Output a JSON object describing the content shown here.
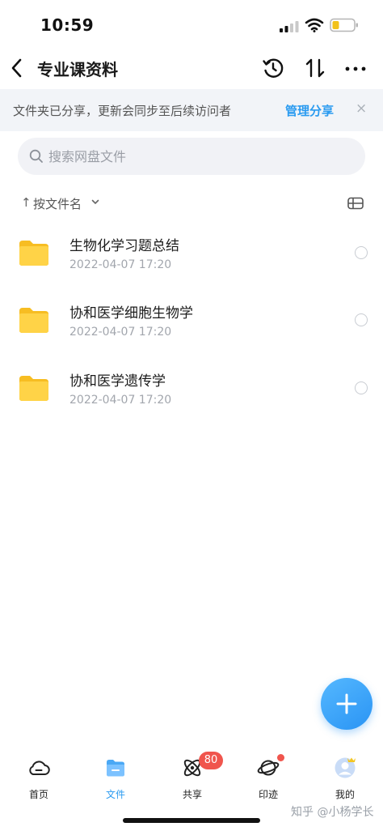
{
  "status_bar": {
    "time": "10:59"
  },
  "nav": {
    "title": "专业课资料"
  },
  "banner": {
    "text": "文件夹已分享，更新会同步至后续访问者",
    "link": "管理分享",
    "close": "×"
  },
  "search": {
    "placeholder": "搜索网盘文件",
    "value": ""
  },
  "sort": {
    "arrow": "↑",
    "label": "按文件名"
  },
  "files": [
    {
      "name": "生物化学习题总结",
      "date": "2022-04-07 17:20"
    },
    {
      "name": "协和医学细胞生物学",
      "date": "2022-04-07 17:20"
    },
    {
      "name": "协和医学遗传学",
      "date": "2022-04-07 17:20"
    }
  ],
  "tabs": [
    {
      "label": "首页",
      "icon": "cloud-icon",
      "active": false
    },
    {
      "label": "文件",
      "icon": "folder-icon",
      "active": true
    },
    {
      "label": "共享",
      "icon": "orbit-icon",
      "active": false,
      "badge": "80"
    },
    {
      "label": "印迹",
      "icon": "planet-icon",
      "active": false,
      "dot": true
    },
    {
      "label": "我的",
      "icon": "avatar-icon",
      "active": false
    }
  ],
  "watermark": "知乎 @小杨学长",
  "colors": {
    "accent": "#2b9bf0",
    "badge": "#f0554d",
    "folder": "#ffcf3f"
  }
}
